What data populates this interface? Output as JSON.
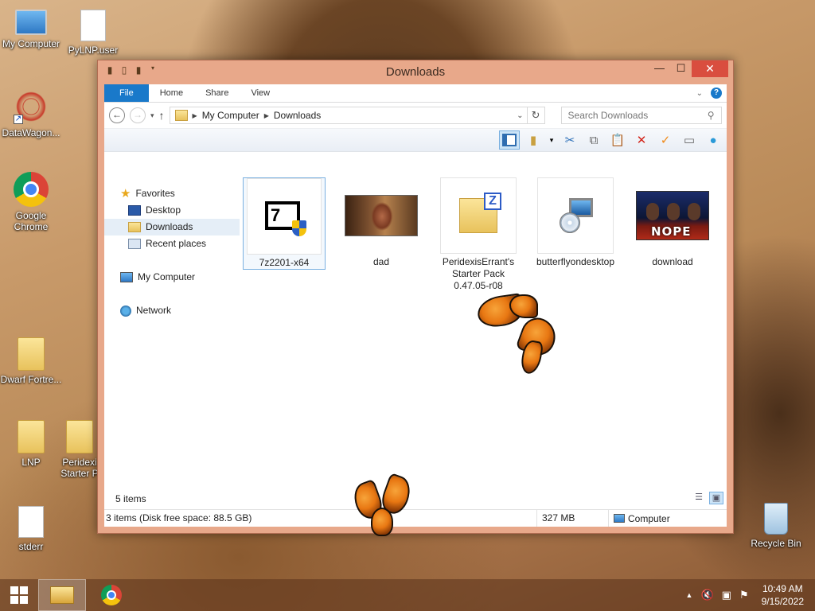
{
  "desktop": {
    "icons": [
      {
        "label": "My Computer",
        "icon": "computer-icon"
      },
      {
        "label": "PyLNP.user",
        "icon": "file-icon"
      },
      {
        "label": "DataWagon...",
        "icon": "datawagon-icon"
      },
      {
        "label": "Google Chrome",
        "icon": "chrome-icon"
      },
      {
        "label": "Dwarf Fortre...",
        "icon": "folder-icon"
      },
      {
        "label": "LNP",
        "icon": "folder-icon"
      },
      {
        "label": "Peridexi Starter P",
        "icon": "zip-folder-icon"
      },
      {
        "label": "stderr",
        "icon": "file-icon"
      },
      {
        "label": "Recycle Bin",
        "icon": "recycle-bin-icon"
      }
    ]
  },
  "window": {
    "title": "Downloads",
    "ribbon_tabs": [
      "File",
      "Home",
      "Share",
      "View"
    ],
    "address": {
      "root": "My Computer",
      "current": "Downloads"
    },
    "search_placeholder": "Search Downloads",
    "nav": {
      "favorites": "Favorites",
      "desktop": "Desktop",
      "downloads": "Downloads",
      "recent": "Recent places",
      "computer": "My Computer",
      "network": "Network"
    },
    "files": [
      {
        "name": "7z2201-x64",
        "icon": "7zip-installer-icon",
        "selected": true
      },
      {
        "name": "dad",
        "icon": "image-thumbnail"
      },
      {
        "name": "PeridexisErrant's Starter Pack 0.47.05-r08",
        "icon": "zip-folder-icon"
      },
      {
        "name": "butterflyondesktop",
        "icon": "setup-icon"
      },
      {
        "name": "download",
        "icon": "image-thumbnail",
        "thumb_text": "NOPE"
      }
    ],
    "status": {
      "items": "5 items",
      "details": "3 items (Disk free space: 88.5 GB)",
      "size": "327 MB",
      "location": "Computer"
    }
  },
  "taskbar": {
    "time": "10:49 AM",
    "date": "9/15/2022"
  },
  "colors": {
    "accent": "#1979ca",
    "window_frame": "#e8a88a",
    "close_button": "#d94e3f"
  }
}
